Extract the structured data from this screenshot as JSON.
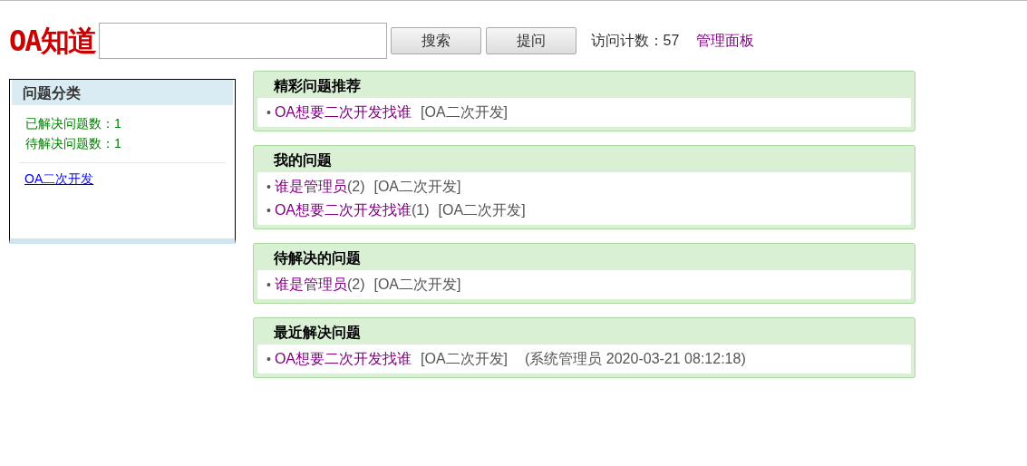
{
  "header": {
    "logo": "OA知道",
    "buttons": [
      "搜索",
      "提问"
    ],
    "visit_count": "访问计数：57",
    "admin_link": "管理面板"
  },
  "sidebar": {
    "title": "问题分类",
    "stats": [
      "已解决问题数：1",
      "待解决问题数：1"
    ],
    "categories": [
      "OA二次开发"
    ]
  },
  "sections": [
    {
      "title": "精彩问题推荐",
      "items": [
        {
          "bullet": "•",
          "link": "OA想要二次开发找谁",
          "category": "[OA二次开发]"
        }
      ]
    },
    {
      "title": "我的问题",
      "items": [
        {
          "bullet": "•",
          "link": "谁是管理员",
          "count": "(2)",
          "category": "[OA二次开发]"
        },
        {
          "bullet": "•",
          "link": "OA想要二次开发找谁",
          "count": "(1)",
          "category": "[OA二次开发]"
        }
      ]
    },
    {
      "title": "待解决的问题",
      "items": [
        {
          "bullet": "•",
          "link": "谁是管理员",
          "count": "(2)",
          "category": "[OA二次开发]"
        }
      ]
    },
    {
      "title": "最近解决问题",
      "items": [
        {
          "bullet": "•",
          "link": "OA想要二次开发找谁",
          "category": "[OA二次开发]",
          "meta": "(系统管理员 2020-03-21 08:12:18)"
        }
      ]
    }
  ]
}
